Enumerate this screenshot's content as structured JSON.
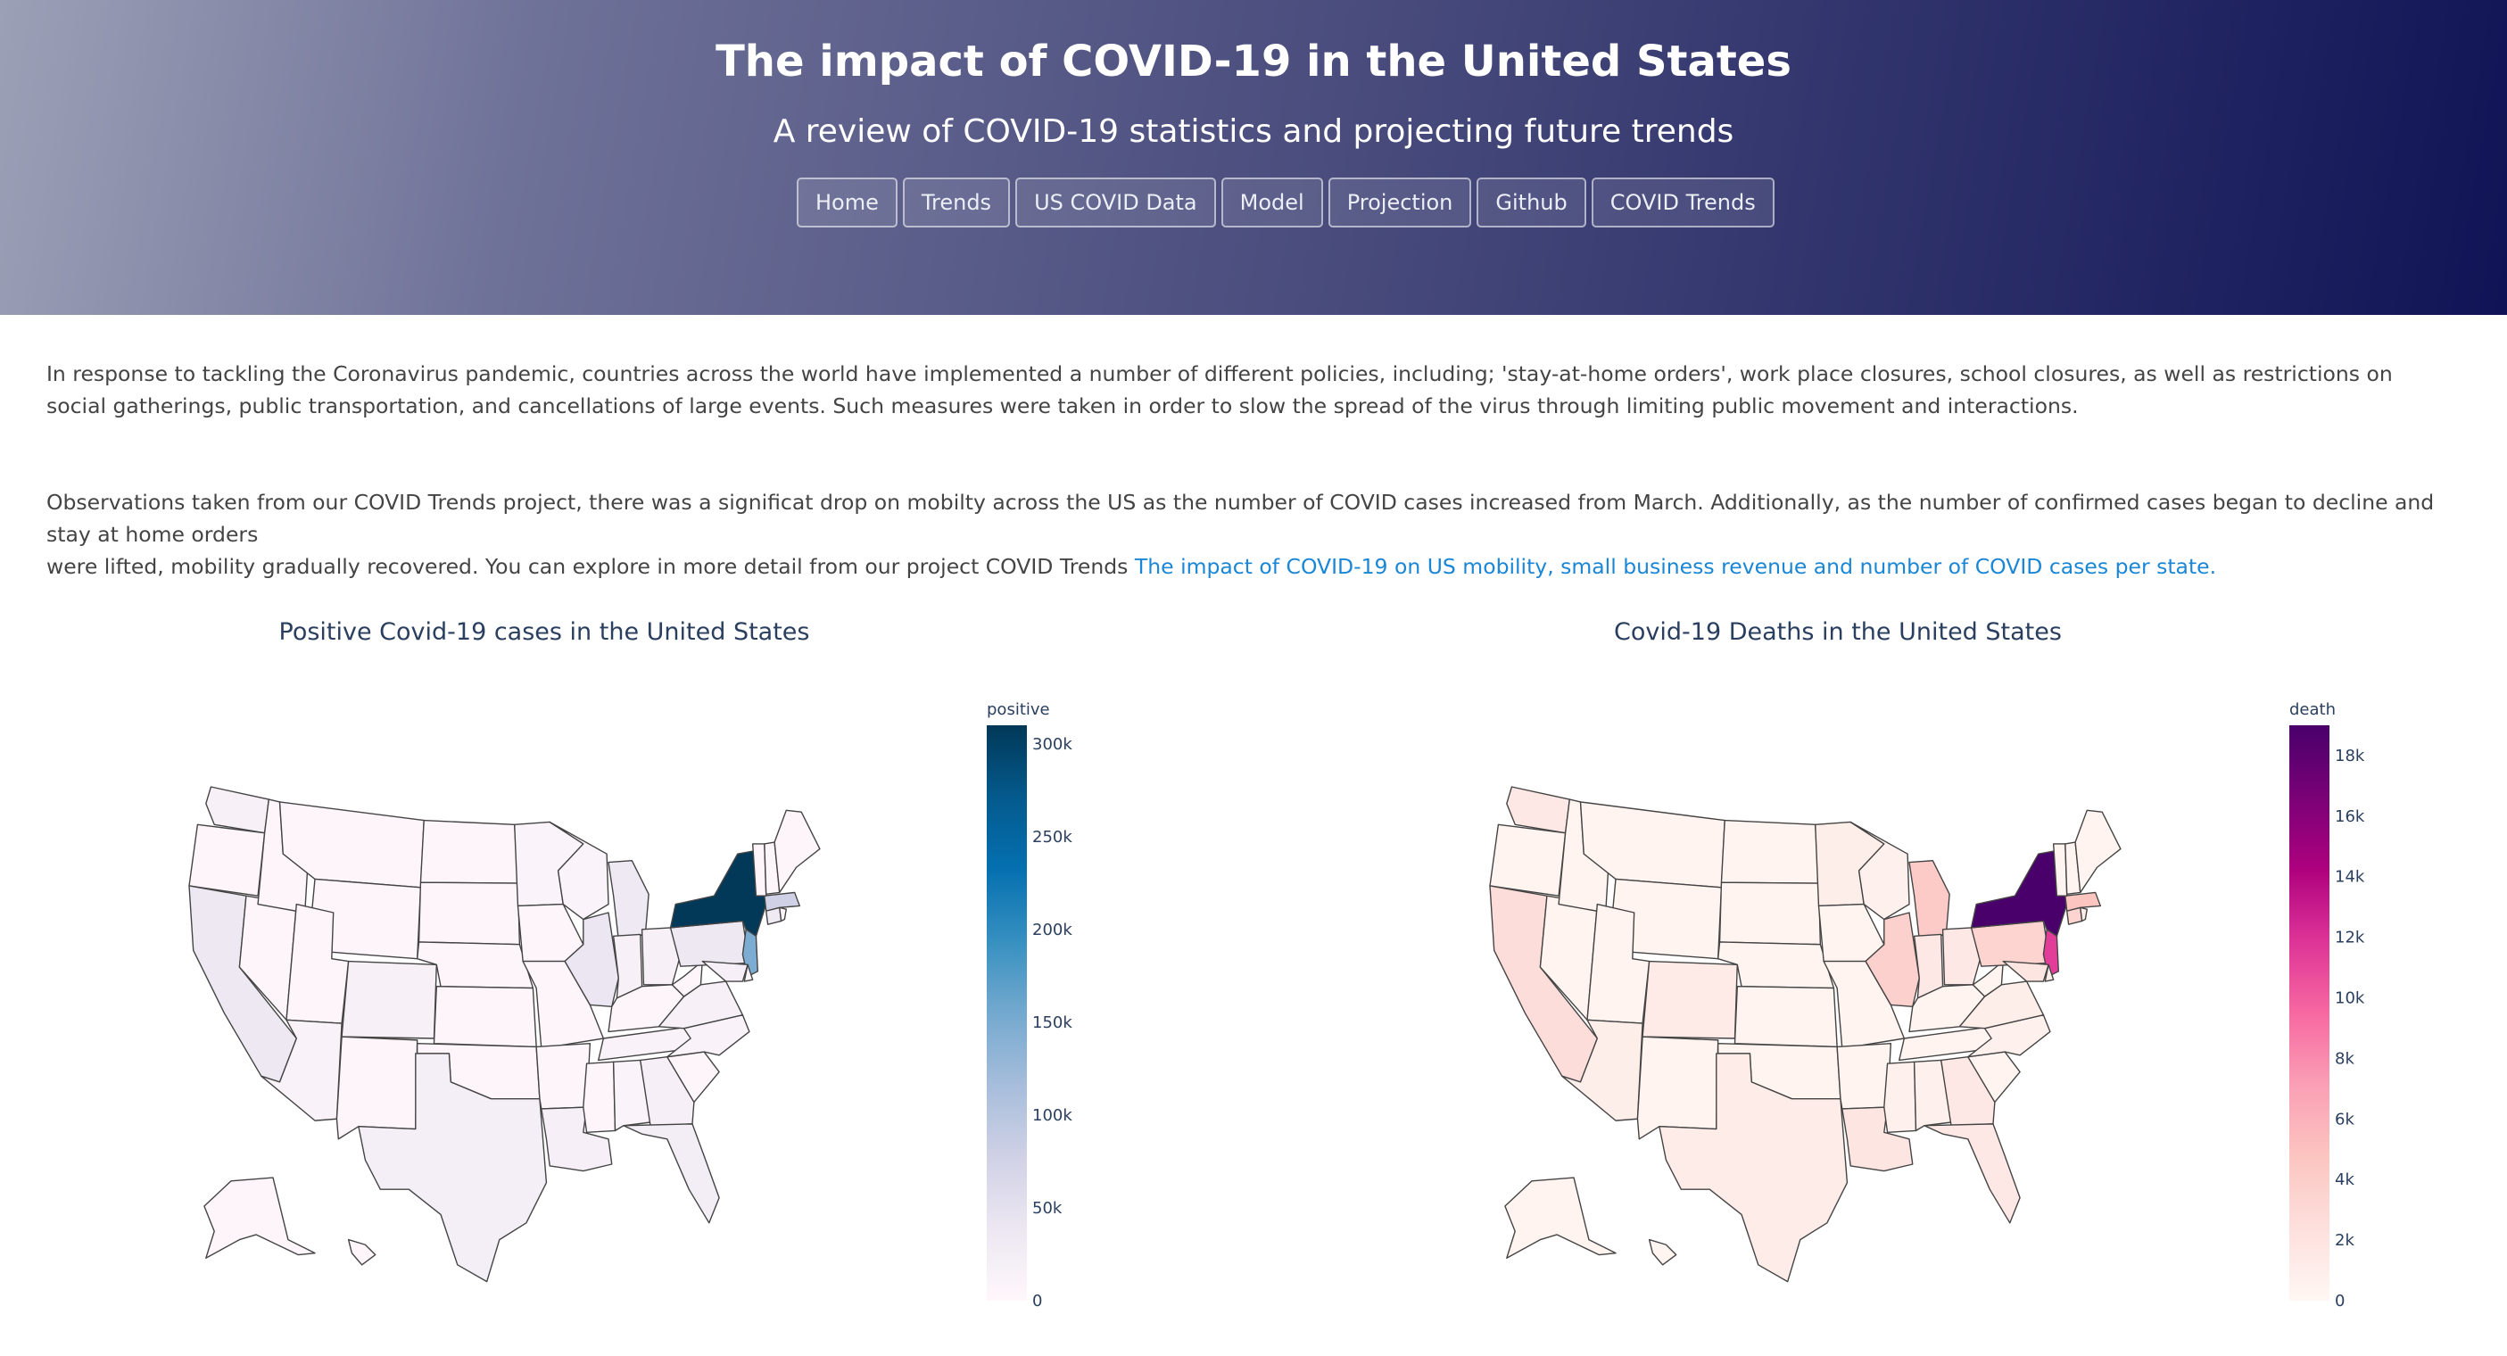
{
  "header": {
    "title": "The impact of COVID-19 in the United States",
    "subtitle": "A review of COVID-19 statistics and projecting future trends",
    "nav": [
      "Home",
      "Trends",
      "US COVID Data",
      "Model",
      "Projection",
      "Github",
      "COVID Trends"
    ]
  },
  "content": {
    "paragraph1": "In response to tackling the Coronavirus pandemic, countries across the world have implemented a number of different policies, including; 'stay-at-home orders', work place closures, school closures, as well as restrictions on social gatherings, public transportation, and cancellations of large events. Such measures were taken in order to slow the spread of the virus through limiting public movement and interactions.",
    "paragraph2_line1": "Observations taken from our COVID Trends project, there was a significat drop on mobilty across the US as the number of COVID cases increased from March. Additionally, as the number of confirmed cases began to decline and stay at home orders",
    "paragraph2_line2": "were lifted, mobility gradually recovered. You can explore in more detail from our project COVID Trends",
    "link_text": "The impact of COVID-19 on US mobility, small business revenue and number of COVID cases per state."
  },
  "maps": [
    {
      "title": "Positive Covid-19 cases in the United States",
      "colorbar_title": "positive",
      "ticks": [
        "0",
        "50k",
        "100k",
        "150k",
        "200k",
        "250k",
        "300k"
      ],
      "tick_values": [
        0,
        50000,
        100000,
        150000,
        200000,
        250000,
        300000
      ],
      "scale_max": 310000,
      "colors": [
        "#fff7fb",
        "#ece7f2",
        "#d0d1e6",
        "#a6bddb",
        "#74a9cf",
        "#3690c0",
        "#0570b0",
        "#045a8d",
        "#023858"
      ]
    },
    {
      "title": "Covid-19 Deaths in the United States",
      "colorbar_title": "death",
      "ticks": [
        "0",
        "2k",
        "4k",
        "6k",
        "8k",
        "10k",
        "12k",
        "14k",
        "16k",
        "18k"
      ],
      "tick_values": [
        0,
        2000,
        4000,
        6000,
        8000,
        10000,
        12000,
        14000,
        16000,
        18000
      ],
      "scale_max": 19000,
      "colors": [
        "#fff7f3",
        "#fde0dd",
        "#fcc5c0",
        "#fa9fb5",
        "#f768a1",
        "#dd3497",
        "#ae017e",
        "#7a0177",
        "#49006a"
      ]
    }
  ]
}
